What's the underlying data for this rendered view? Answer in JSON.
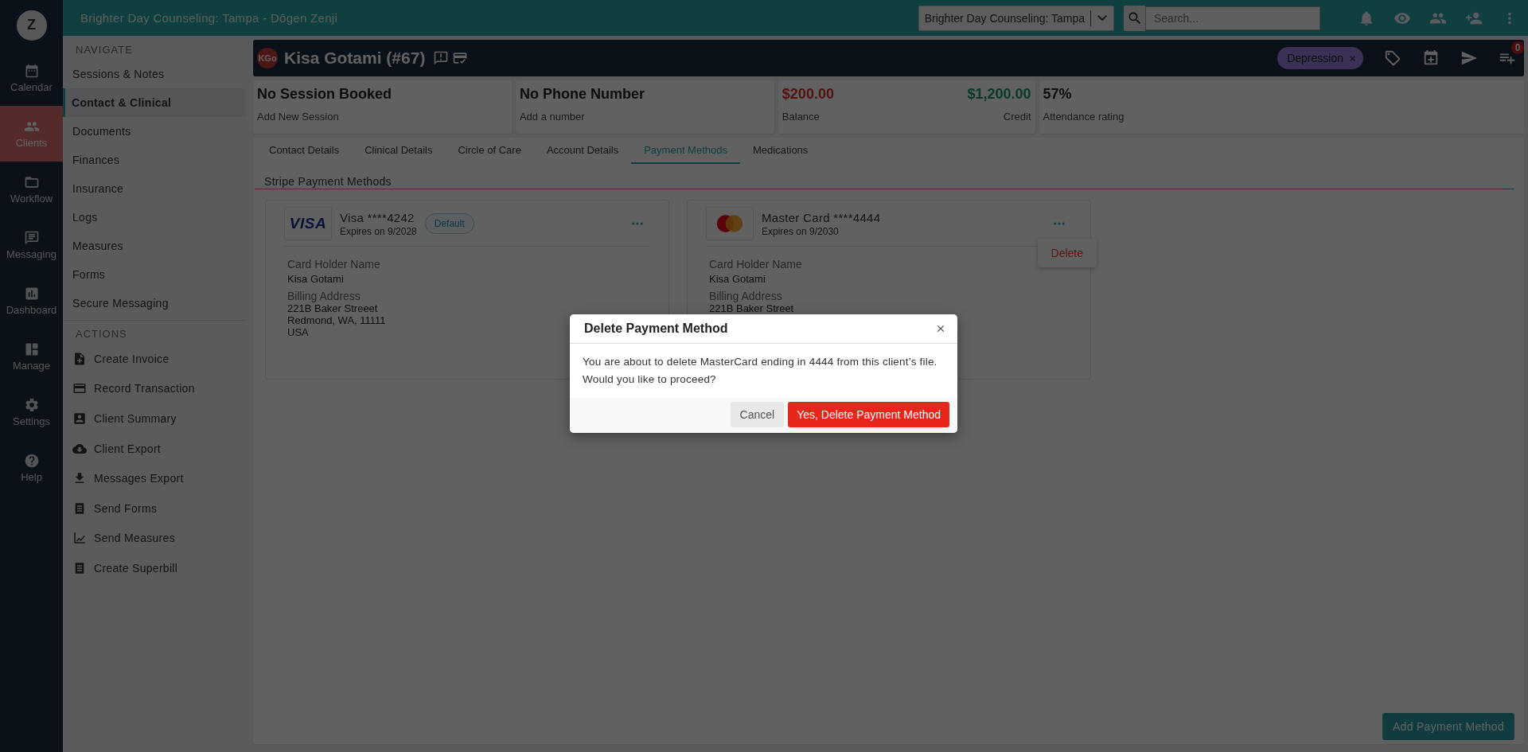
{
  "rail": {
    "logo": "Z",
    "items": [
      {
        "label": "Calendar",
        "selected": false
      },
      {
        "label": "Clients",
        "selected": true
      },
      {
        "label": "Workflow",
        "selected": false
      },
      {
        "label": "Messaging",
        "selected": false
      },
      {
        "label": "Dashboard",
        "selected": false
      },
      {
        "label": "Manage",
        "selected": false
      },
      {
        "label": "Settings",
        "selected": false
      },
      {
        "label": "Help",
        "selected": false
      }
    ]
  },
  "topbar": {
    "title": "Brighter Day Counseling: Tampa - Dōgen Zenji",
    "practice_select": "Brighter Day Counseling: Tampa",
    "search": {
      "placeholder": "Search..."
    }
  },
  "sidebar": {
    "navigate_heading": "NAVIGATE",
    "items": [
      {
        "label": "Sessions & Notes",
        "selected": false
      },
      {
        "label": "Contact & Clinical",
        "selected": true
      },
      {
        "label": "Documents",
        "selected": false
      },
      {
        "label": "Finances",
        "selected": false
      },
      {
        "label": "Insurance",
        "selected": false
      },
      {
        "label": "Logs",
        "selected": false
      },
      {
        "label": "Measures",
        "selected": false
      },
      {
        "label": "Forms",
        "selected": false
      },
      {
        "label": "Secure Messaging",
        "selected": false
      }
    ],
    "actions_heading": "ACTIONS",
    "actions": [
      "Create Invoice",
      "Record Transaction",
      "Client Summary",
      "Client Export",
      "Messages Export",
      "Send Forms",
      "Send Measures",
      "Create Superbill"
    ]
  },
  "client": {
    "initials": "KGo",
    "name": "Kisa Gotami (#67)",
    "tag": "Depression",
    "notification_count": "0"
  },
  "stats": [
    {
      "kind": "plain",
      "value": "No Session Booked",
      "label": "Add New Session"
    },
    {
      "kind": "plain",
      "value": "No Phone Number",
      "label": "Add a number"
    },
    {
      "kind": "balance",
      "value": "$200.00",
      "label": "Balance",
      "value_2": "$1,200.00",
      "label_2": "Credit"
    },
    {
      "kind": "plain",
      "value": "57%",
      "label": "Attendance rating"
    }
  ],
  "tabs": [
    {
      "label": "Contact Details",
      "selected": false
    },
    {
      "label": "Clinical Details",
      "selected": false
    },
    {
      "label": "Circle of Care",
      "selected": false
    },
    {
      "label": "Account Details",
      "selected": false
    },
    {
      "label": "Payment Methods",
      "selected": true
    },
    {
      "label": "Medications",
      "selected": false
    }
  ],
  "section_title": "Stripe Payment Methods",
  "cards": [
    {
      "kind": "visa",
      "logo": "VISA",
      "title": "Visa ****4242",
      "expires": "Expires on 9/2028",
      "badge": "Default",
      "holder_label": "Card Holder Name",
      "holder": "Kisa Gotami",
      "address_label": "Billing Address",
      "address": [
        "221B Baker Streeet",
        "Redmond, WA, 11111",
        "USA"
      ]
    },
    {
      "kind": "mastercard",
      "title": "Master Card ****4444",
      "expires": "Expires on 9/2030",
      "menu": [
        "Delete"
      ],
      "holder_label": "Card Holder Name",
      "holder": "Kisa Gotami",
      "address_label": "Billing Address",
      "address": [
        "221B Baker Street"
      ]
    }
  ],
  "add_button": "Add Payment Method",
  "modal": {
    "title": "Delete Payment Method",
    "message": "You are about to delete MasterCard ending in 4444 from this client’s file. Would you like to proceed?",
    "cancel": "Cancel",
    "confirm": "Yes, Delete Payment Method"
  }
}
